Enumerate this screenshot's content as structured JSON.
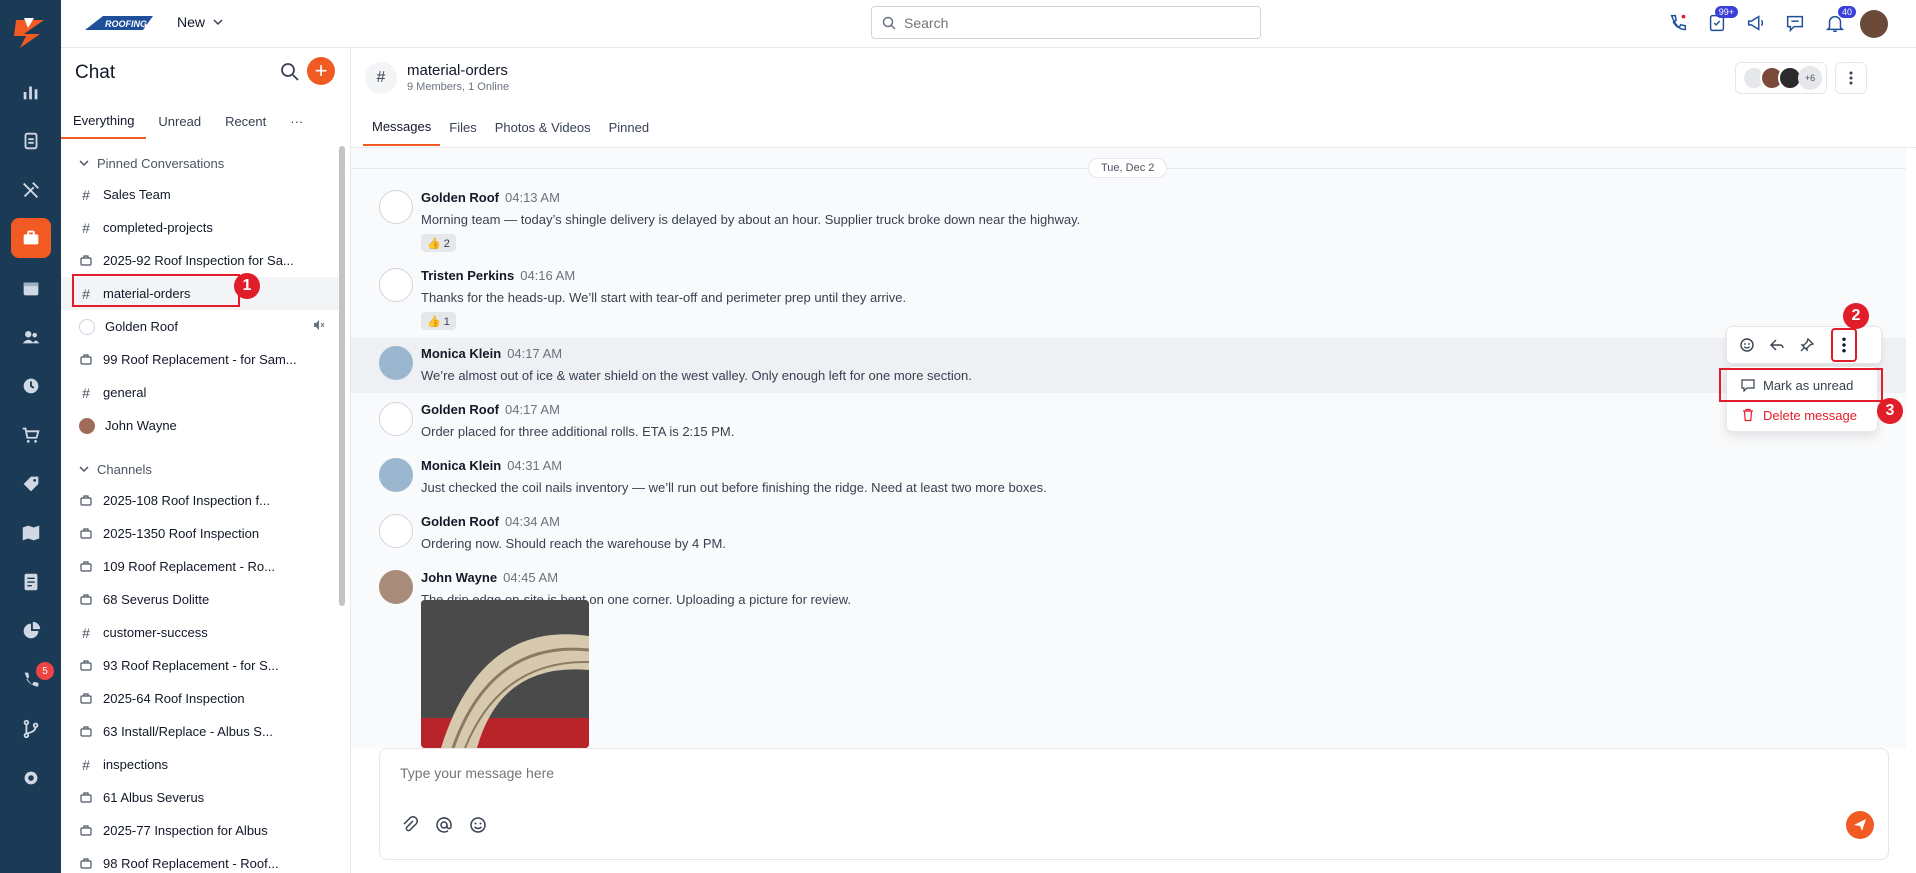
{
  "topbar": {
    "brand_text": "ROOFING",
    "new_label": "New",
    "search_placeholder": "Search",
    "tasks_badge": "99+",
    "notifications_badge": "40"
  },
  "rail": {
    "phone_badge": "5"
  },
  "panel": {
    "title": "Chat",
    "tabs": [
      "Everything",
      "Unread",
      "Recent",
      "···"
    ],
    "pinned_label": "Pinned Conversations",
    "pinned": [
      {
        "icon": "hash",
        "label": "Sales Team"
      },
      {
        "icon": "hash",
        "label": "completed-projects"
      },
      {
        "icon": "briefcase",
        "label": "2025-92 Roof Inspection for Sa..."
      },
      {
        "icon": "hash",
        "label": "material-orders"
      },
      {
        "icon": "avatar",
        "label": "Golden Roof"
      },
      {
        "icon": "briefcase",
        "label": "99 Roof Replacement - for Sam..."
      },
      {
        "icon": "hash",
        "label": "general"
      },
      {
        "icon": "photo",
        "label": "John Wayne"
      }
    ],
    "channels_label": "Channels",
    "channels": [
      {
        "icon": "briefcase",
        "label": "2025-108 Roof Inspection f..."
      },
      {
        "icon": "briefcase",
        "label": "2025-1350 Roof Inspection"
      },
      {
        "icon": "briefcase",
        "label": "109 Roof Replacement - Ro..."
      },
      {
        "icon": "briefcase",
        "label": "68 Severus Dolitte"
      },
      {
        "icon": "hash",
        "label": "customer-success"
      },
      {
        "icon": "briefcase",
        "label": "93 Roof Replacement - for S..."
      },
      {
        "icon": "briefcase",
        "label": "2025-64 Roof Inspection"
      },
      {
        "icon": "briefcase",
        "label": "63 Install/Replace - Albus S..."
      },
      {
        "icon": "hash",
        "label": "inspections"
      },
      {
        "icon": "briefcase",
        "label": "61 Albus Severus"
      },
      {
        "icon": "briefcase",
        "label": "2025-77 Inspection for Albus"
      },
      {
        "icon": "briefcase",
        "label": "98 Roof Replacement - Roof..."
      }
    ]
  },
  "channel": {
    "name": "material-orders",
    "subtitle": "9 Members, 1 Online",
    "tabs": [
      "Messages",
      "Files",
      "Photos & Videos",
      "Pinned"
    ],
    "members_more": "+6"
  },
  "date_divider": "Tue, Dec 2",
  "messages": [
    {
      "name": "Golden Roof",
      "time": "04:13 AM",
      "text": "Morning team — today’s shingle delivery is delayed by about an hour. Supplier truck broke down near the highway.",
      "reaction": "👍 2"
    },
    {
      "name": "Tristen Perkins",
      "time": "04:16 AM",
      "text": "Thanks for the heads-up. We’ll start with tear-off and perimeter prep until they arrive.",
      "reaction": "👍 1"
    },
    {
      "name": "Monica Klein",
      "time": "04:17 AM",
      "text": "We’re almost out of ice & water shield on the west valley. Only enough left for one more section."
    },
    {
      "name": "Golden Roof",
      "time": "04:17 AM",
      "text": "Order placed for three additional rolls. ETA is 2:15 PM."
    },
    {
      "name": "Monica Klein",
      "time": "04:31 AM",
      "text": "Just checked the coil nails inventory — we’ll run out before finishing the ridge. Need at least two more boxes."
    },
    {
      "name": "Golden Roof",
      "time": "04:34 AM",
      "text": "Ordering now. Should reach the warehouse by 4 PM."
    },
    {
      "name": "John Wayne",
      "time": "04:45 AM",
      "text": "The drip edge on-site is bent on one corner. Uploading a picture for review."
    }
  ],
  "context_menu": {
    "mark_unread": "Mark as unread",
    "delete": "Delete message"
  },
  "steps": [
    "1",
    "2",
    "3"
  ],
  "composer": {
    "placeholder": "Type your message here"
  },
  "colors": {
    "accent": "#f15a22",
    "rail": "#1b3a55",
    "annotation": "#e11d2a"
  }
}
